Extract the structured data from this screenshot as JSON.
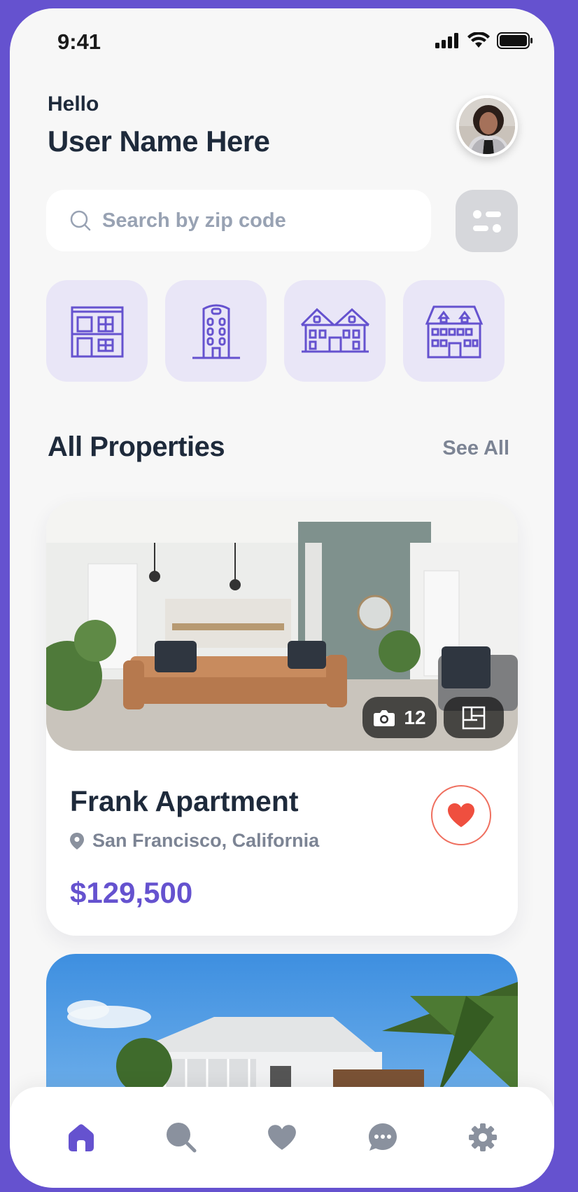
{
  "status_bar": {
    "time": "9:41"
  },
  "header": {
    "greeting": "Hello",
    "user_name": "User Name Here"
  },
  "search": {
    "placeholder": "Search by zip code"
  },
  "categories": [
    {
      "icon": "apartment-building-icon"
    },
    {
      "icon": "tower-building-icon"
    },
    {
      "icon": "townhouse-icon"
    },
    {
      "icon": "house-icon"
    }
  ],
  "section": {
    "title": "All Properties",
    "see_all": "See All"
  },
  "properties": [
    {
      "name": "Frank Apartment",
      "location": "San Francisco, California",
      "price": "$129,500",
      "photo_count": "12",
      "favorited": true
    }
  ],
  "tabbar": {
    "items": [
      "home-icon",
      "search-icon",
      "heart-icon",
      "chat-icon",
      "settings-icon"
    ],
    "active": "home-icon"
  },
  "colors": {
    "accent": "#6552CF",
    "heart": "#EF4F3F",
    "title": "#1E2A3B",
    "muted": "#7C8494",
    "category_bg": "#E9E6F7"
  }
}
